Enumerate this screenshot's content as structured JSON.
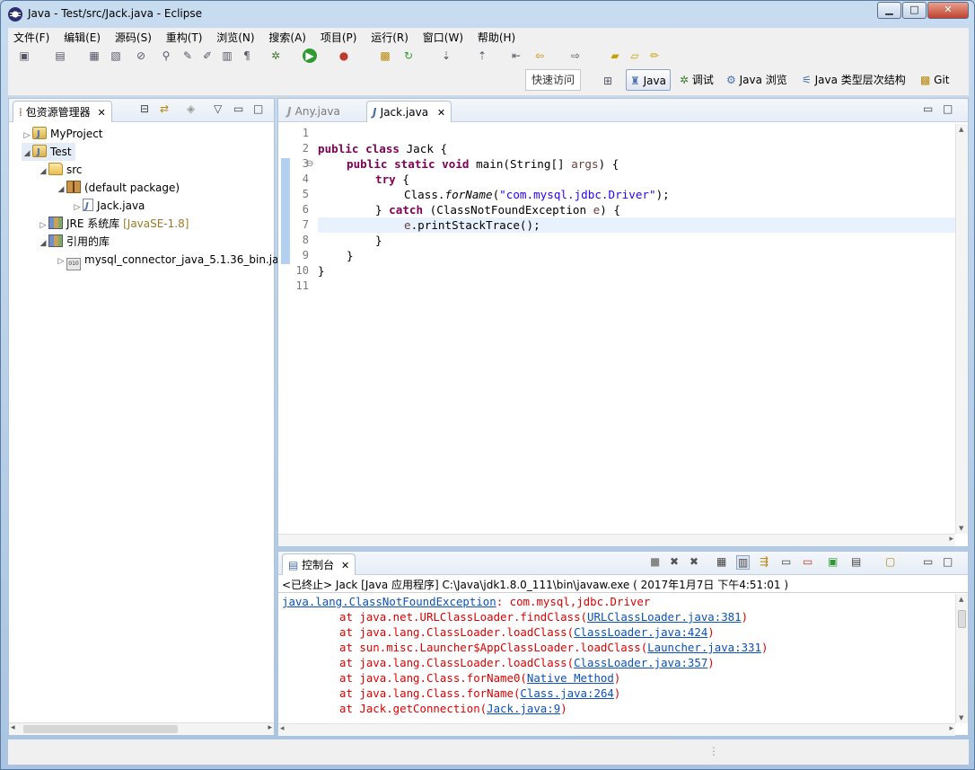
{
  "window": {
    "title": "Java  -  Test/src/Jack.java  -  Eclipse",
    "btn_min": "▁",
    "btn_max": "□",
    "btn_close": "✕"
  },
  "menu": [
    "文件(F)",
    "编辑(E)",
    "源码(S)",
    "重构(T)",
    "浏览(N)",
    "搜索(A)",
    "项目(P)",
    "运行(R)",
    "窗口(W)",
    "帮助(H)"
  ],
  "toolbar": {
    "quick_access": "快速访问",
    "perspectives": [
      {
        "label": "Java",
        "active": true
      },
      {
        "label": "调试",
        "active": false
      },
      {
        "label": "Java 浏览",
        "active": false
      },
      {
        "label": "Java 类型层次结构",
        "active": false
      },
      {
        "label": "Git",
        "active": false
      }
    ]
  },
  "explorer": {
    "tab_label": "包资源管理器",
    "nodes": [
      {
        "label": "MyProject",
        "icon": "project-icon",
        "twisty": "▷",
        "decor": ""
      },
      {
        "label": "Test",
        "icon": "project-icon",
        "twisty": "◢",
        "decor": ""
      },
      {
        "label": "src",
        "icon": "source-folder-icon",
        "twisty": "◢",
        "decor": ""
      },
      {
        "label": "(default package)",
        "icon": "package-icon",
        "twisty": "◢",
        "decor": ""
      },
      {
        "label": "Jack.java",
        "icon": "java-file-icon",
        "twisty": "▷",
        "decor": ""
      },
      {
        "label": "JRE 系统库",
        "icon": "library-icon",
        "twisty": "▷",
        "decor": "[JavaSE-1.8]"
      },
      {
        "label": "引用的库",
        "icon": "library-icon",
        "twisty": "◢",
        "decor": ""
      },
      {
        "label": "mysql_connector_java_5.1.36_bin.jar",
        "icon": "jar-icon",
        "twisty": "▷",
        "decor": ""
      }
    ]
  },
  "editor": {
    "tabs": [
      {
        "label": "Any.java",
        "active": false
      },
      {
        "label": "Jack.java",
        "active": true
      }
    ],
    "line_numbers": [
      "1",
      "2",
      "3",
      "4",
      "5",
      "6",
      "7",
      "8",
      "9",
      "10",
      "11"
    ],
    "fold_marker": "⊖",
    "code": {
      "l2_kw": "public class",
      "l2_rest": " Jack {",
      "l3_kw": "public static void",
      "l3_rest": " main(String[] ",
      "l3_param": "args",
      "l3_end": ") {",
      "l4_kw": "try",
      "l4_rest": " {",
      "l5_pre": "Class.",
      "l5_method": "forName",
      "l5_open": "(",
      "l5_str": "\"com.mysql.jdbc.Driver\"",
      "l5_end": ");",
      "l6_pre": "} ",
      "l6_kw": "catch",
      "l6_rest": " (ClassNotFoundException ",
      "l6_param": "e",
      "l6_end": ") {",
      "l7_param": "e",
      "l7_rest": ".printStackTrace();",
      "l8": "}",
      "l9": "}",
      "l10": "}"
    }
  },
  "console": {
    "tab_label": "控制台",
    "header": "<已终止> Jack [Java 应用程序] C:\\Java\\jdk1.8.0_111\\bin\\javaw.exe ( 2017年1月7日 下午4:51:01 )",
    "exception_class": "java.lang.ClassNotFoundException",
    "exception_msg": ": com.mysql,jdbc.Driver",
    "frames": [
      {
        "text": "at java.net.URLClassLoader.findClass(",
        "link": "URLClassLoader.java:381",
        "end": ")"
      },
      {
        "text": "at java.lang.ClassLoader.loadClass(",
        "link": "ClassLoader.java:424",
        "end": ")"
      },
      {
        "text": "at sun.misc.Launcher$AppClassLoader.loadClass(",
        "link": "Launcher.java:331",
        "end": ")"
      },
      {
        "text": "at java.lang.ClassLoader.loadClass(",
        "link": "ClassLoader.java:357",
        "end": ")"
      },
      {
        "text": "at java.lang.Class.forName0(",
        "link": "Native Method",
        "end": ")"
      },
      {
        "text": "at java.lang.Class.forName(",
        "link": "Class.java:264",
        "end": ")"
      },
      {
        "text": "at Jack.getConnection(",
        "link": "Jack.java:9",
        "end": ")"
      }
    ]
  },
  "icons": {
    "close": "✕",
    "minimize": "▭",
    "maximize": "□",
    "menu_down": "▽",
    "scroll_up": "▲",
    "scroll_down": "▼",
    "scroll_left": "◂",
    "scroll_right": "▸",
    "grip": "⋮"
  }
}
